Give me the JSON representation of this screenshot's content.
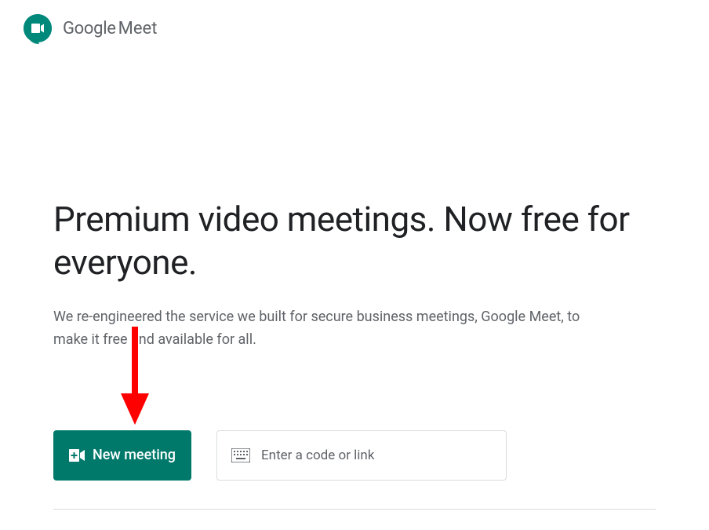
{
  "header": {
    "logo_google": "Google",
    "logo_meet": "Meet"
  },
  "main": {
    "headline": "Premium video meetings. Now free for everyone.",
    "subtext": "We re-engineered the service we built for secure business meetings, Google Meet, to make it free and available for all."
  },
  "actions": {
    "new_meeting_label": "New meeting",
    "code_input_placeholder": "Enter a code or link"
  },
  "colors": {
    "primary": "#00796b",
    "text_primary": "#202124",
    "text_secondary": "#5f6368",
    "arrow": "#ff0000"
  }
}
